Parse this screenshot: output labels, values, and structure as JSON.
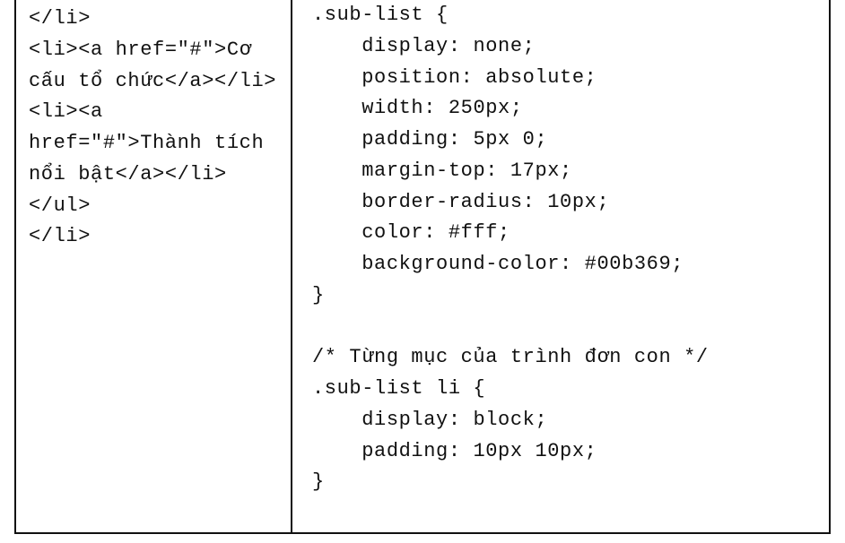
{
  "left_column": {
    "code": "</li>\n<li><a href=\"#\">Cơ cấu tổ chức</a></li>\n<li><a  href=\"#\">Thành tích nổi bật</a></li>\n</ul>\n</li>"
  },
  "right_column": {
    "code": ".sub-list {\n    display: none;\n    position: absolute;\n    width: 250px;\n    padding: 5px 0;\n    margin-top: 17px;\n    border-radius: 10px;\n    color: #fff;\n    background-color: #00b369;\n}\n\n/* Từng mục của trình đơn con */\n.sub-list li {\n    display: block;\n    padding: 10px 10px;\n}"
  }
}
